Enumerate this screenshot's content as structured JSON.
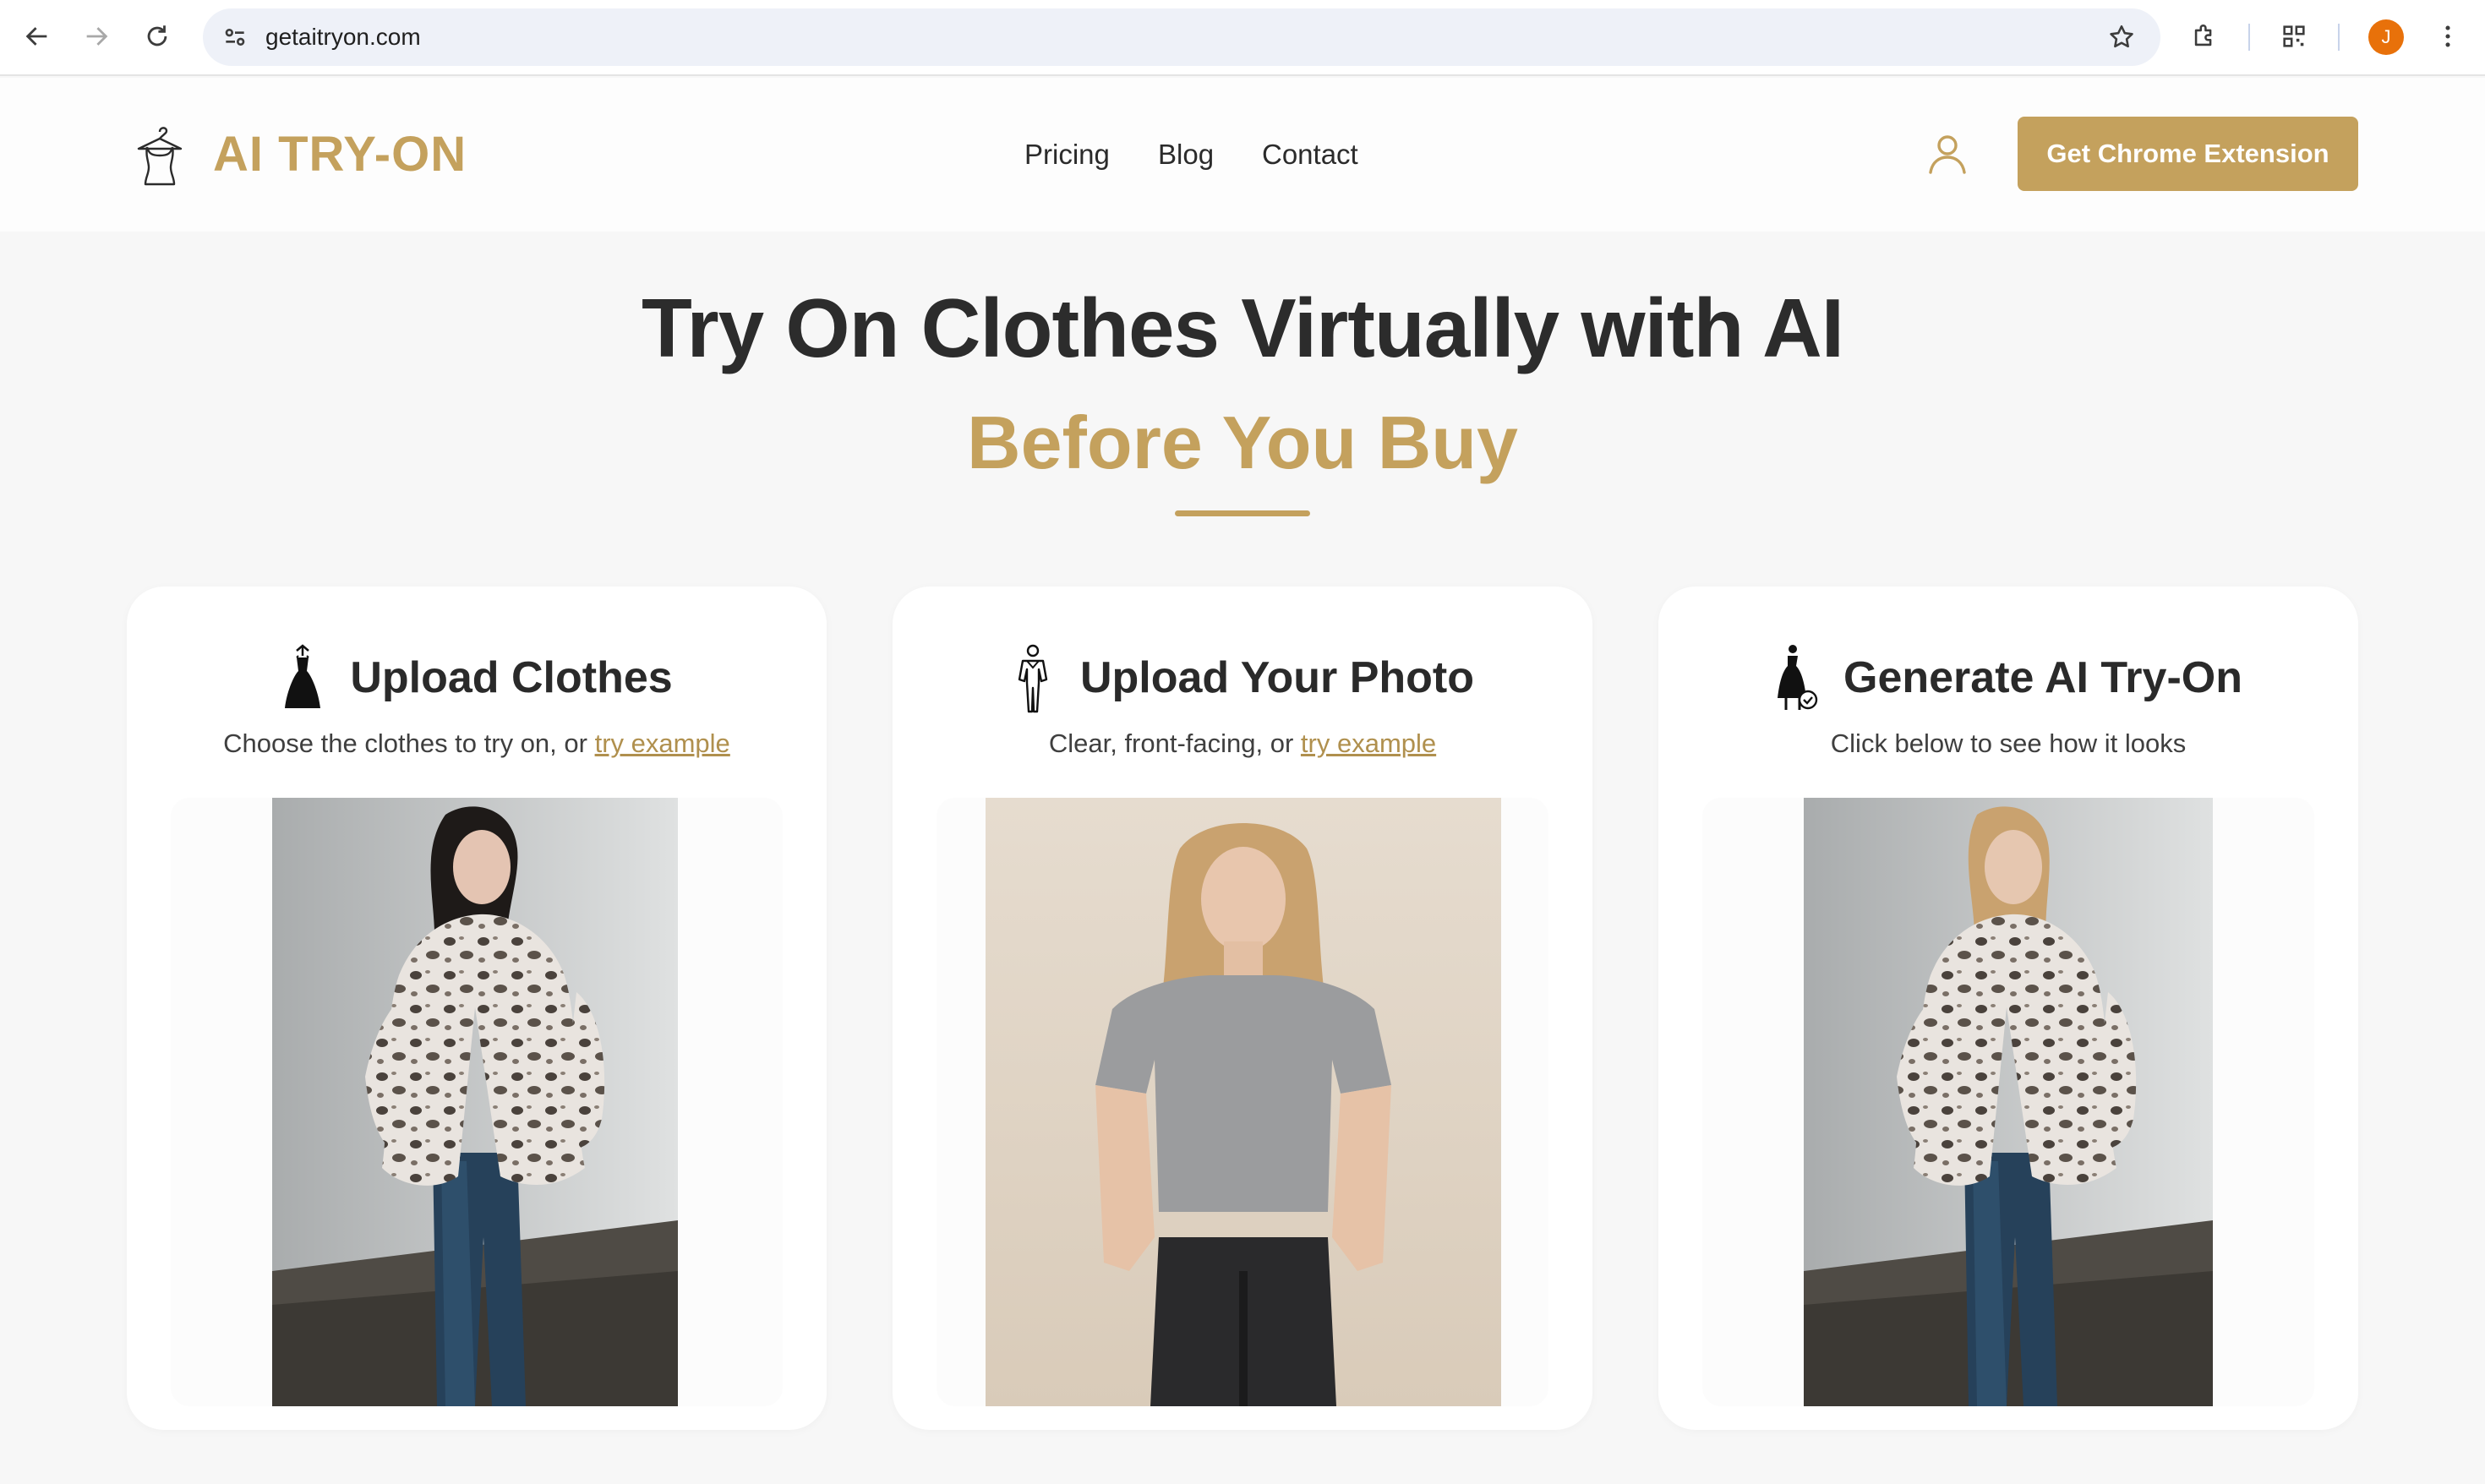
{
  "browser": {
    "url": "getaitryon.com",
    "profile_initial": "J",
    "icons": [
      "back-icon",
      "forward-icon",
      "reload-icon",
      "site-info-icon",
      "bookmark-star-icon",
      "extensions-icon",
      "qr-code-icon",
      "menu-kebab-icon"
    ]
  },
  "header": {
    "logo_text": "AI TRY-ON",
    "nav": [
      "Pricing",
      "Blog",
      "Contact"
    ],
    "cta_label": "Get Chrome Extension"
  },
  "hero": {
    "title": "Try On Clothes Virtually with AI",
    "subtitle": "Before You Buy"
  },
  "cards": [
    {
      "icon": "dress-hanger-icon",
      "title": "Upload Clothes",
      "desc_prefix": "Choose the clothes to try on, or ",
      "desc_link": "try example",
      "image": "model-fur-coat-photo"
    },
    {
      "icon": "person-figure-icon",
      "title": "Upload Your Photo",
      "desc_prefix": "Clear, front-facing, or ",
      "desc_link": "try example",
      "image": "person-gray-tshirt-photo"
    },
    {
      "icon": "dress-check-icon",
      "title": "Generate AI Try-On",
      "desc_prefix": "Click below to see how it looks",
      "desc_link": "",
      "image": "tryon-result-photo"
    }
  ],
  "colors": {
    "brand_gold": "#c4a15d",
    "link_gold": "#b0904e",
    "text_dark": "#2c2c2c",
    "page_bg": "#f7f7f7",
    "avatar_orange": "#e8710a"
  }
}
